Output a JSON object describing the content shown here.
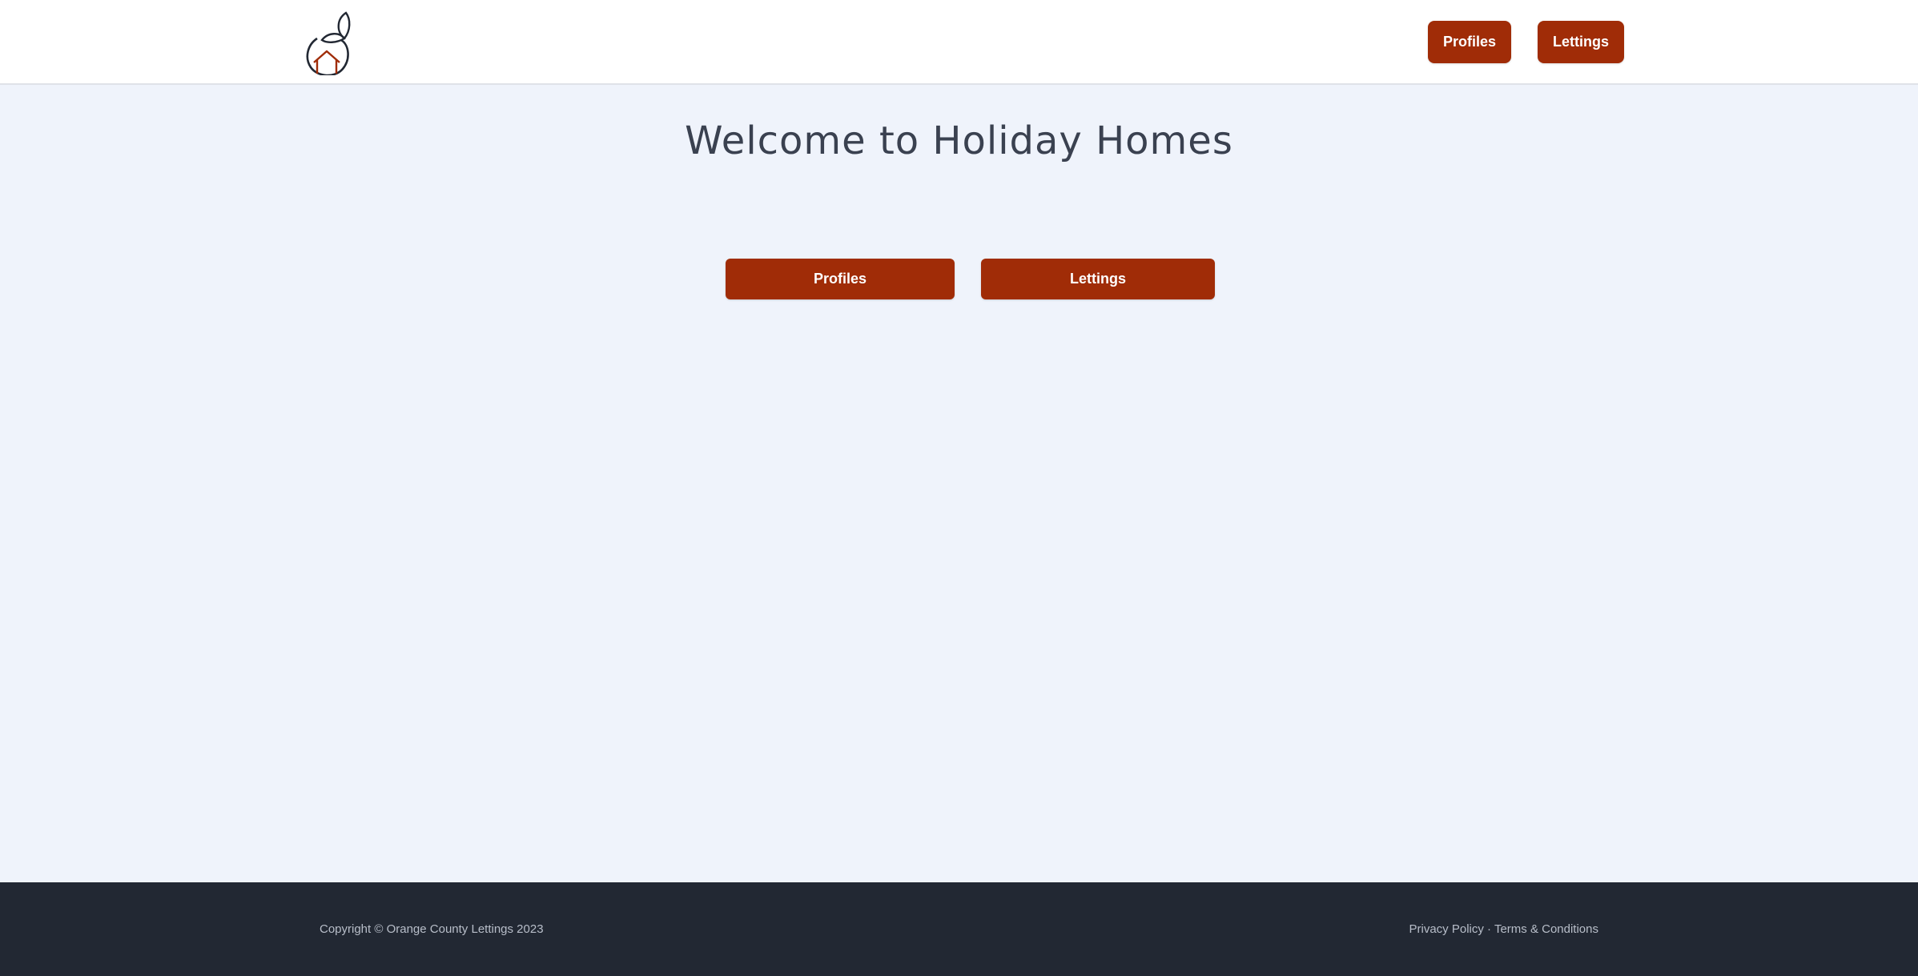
{
  "header": {
    "logo_icon": "orange-house-icon",
    "nav": {
      "profiles_label": "Profiles",
      "lettings_label": "Lettings"
    }
  },
  "main": {
    "title": "Welcome to Holiday Homes",
    "profiles_label": "Profiles",
    "lettings_label": "Lettings"
  },
  "footer": {
    "copyright": "Copyright © Orange County Lettings 2023",
    "privacy_label": "Privacy Policy",
    "separator": "·",
    "terms_label": "Terms & Conditions"
  },
  "colors": {
    "accent": "#a02c07",
    "page_background": "#eff3fb",
    "footer_background": "#222833",
    "title_text": "#3a4150"
  }
}
